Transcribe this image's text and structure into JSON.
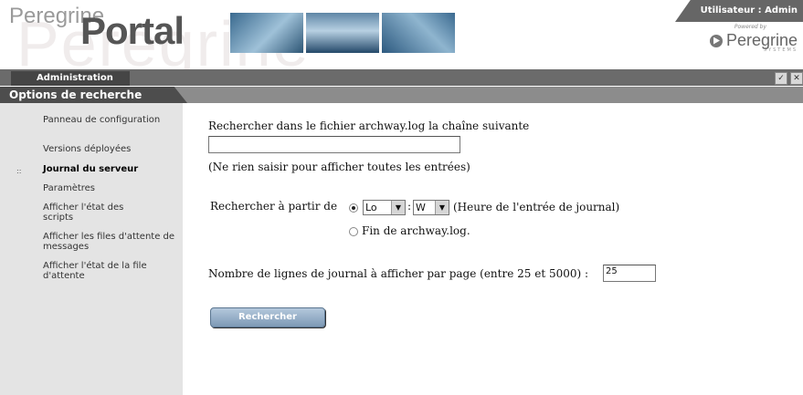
{
  "header": {
    "logo_small": "Peregrine",
    "logo_big": "Portal",
    "user_label": "Utilisateur : Admin",
    "powered_by": "Powered by",
    "brand": "Peregrine",
    "brand_sub": "SYSTEMS"
  },
  "nav": {
    "tab_label": "Administration",
    "accept_glyph": "✓",
    "close_glyph": "✕"
  },
  "section": {
    "title": "Options de recherche"
  },
  "sidebar": {
    "items": [
      {
        "label": "Panneau de configuration",
        "active": false
      },
      {
        "label": "Versions déployées",
        "active": false
      },
      {
        "label": "Journal du serveur",
        "active": true
      },
      {
        "label": "Paramètres",
        "active": false
      },
      {
        "label": "Afficher l'état des scripts",
        "active": false
      },
      {
        "label": "Afficher les files d'attente de messages",
        "active": false
      },
      {
        "label": "Afficher l'état de la file d'attente",
        "active": false
      }
    ],
    "active_bullet": "::"
  },
  "main": {
    "search_label": "Rechercher dans le fichier archway.log la chaîne suivante",
    "search_value": "",
    "search_hint": "(Ne rien saisir pour afficher toutes les entrées)",
    "from_label": "Rechercher à partir de",
    "day_value": "Lo",
    "colon": ":",
    "time_value": "W",
    "entry_time_note": "(Heure de l'entrée de journal)",
    "end_option": "Fin de archway.log.",
    "lines_label": "Nombre de lignes de journal à afficher par page (entre 25 et 5000) :",
    "lines_value": "25",
    "search_button": "Rechercher"
  },
  "colors": {
    "nav_bar": "#6b6b6b",
    "section_bar": "#8c8c8c",
    "section_title_bg": "#4d4d4d",
    "sidebar_bg": "#e4e4e4",
    "button": "#8aa6c2"
  }
}
